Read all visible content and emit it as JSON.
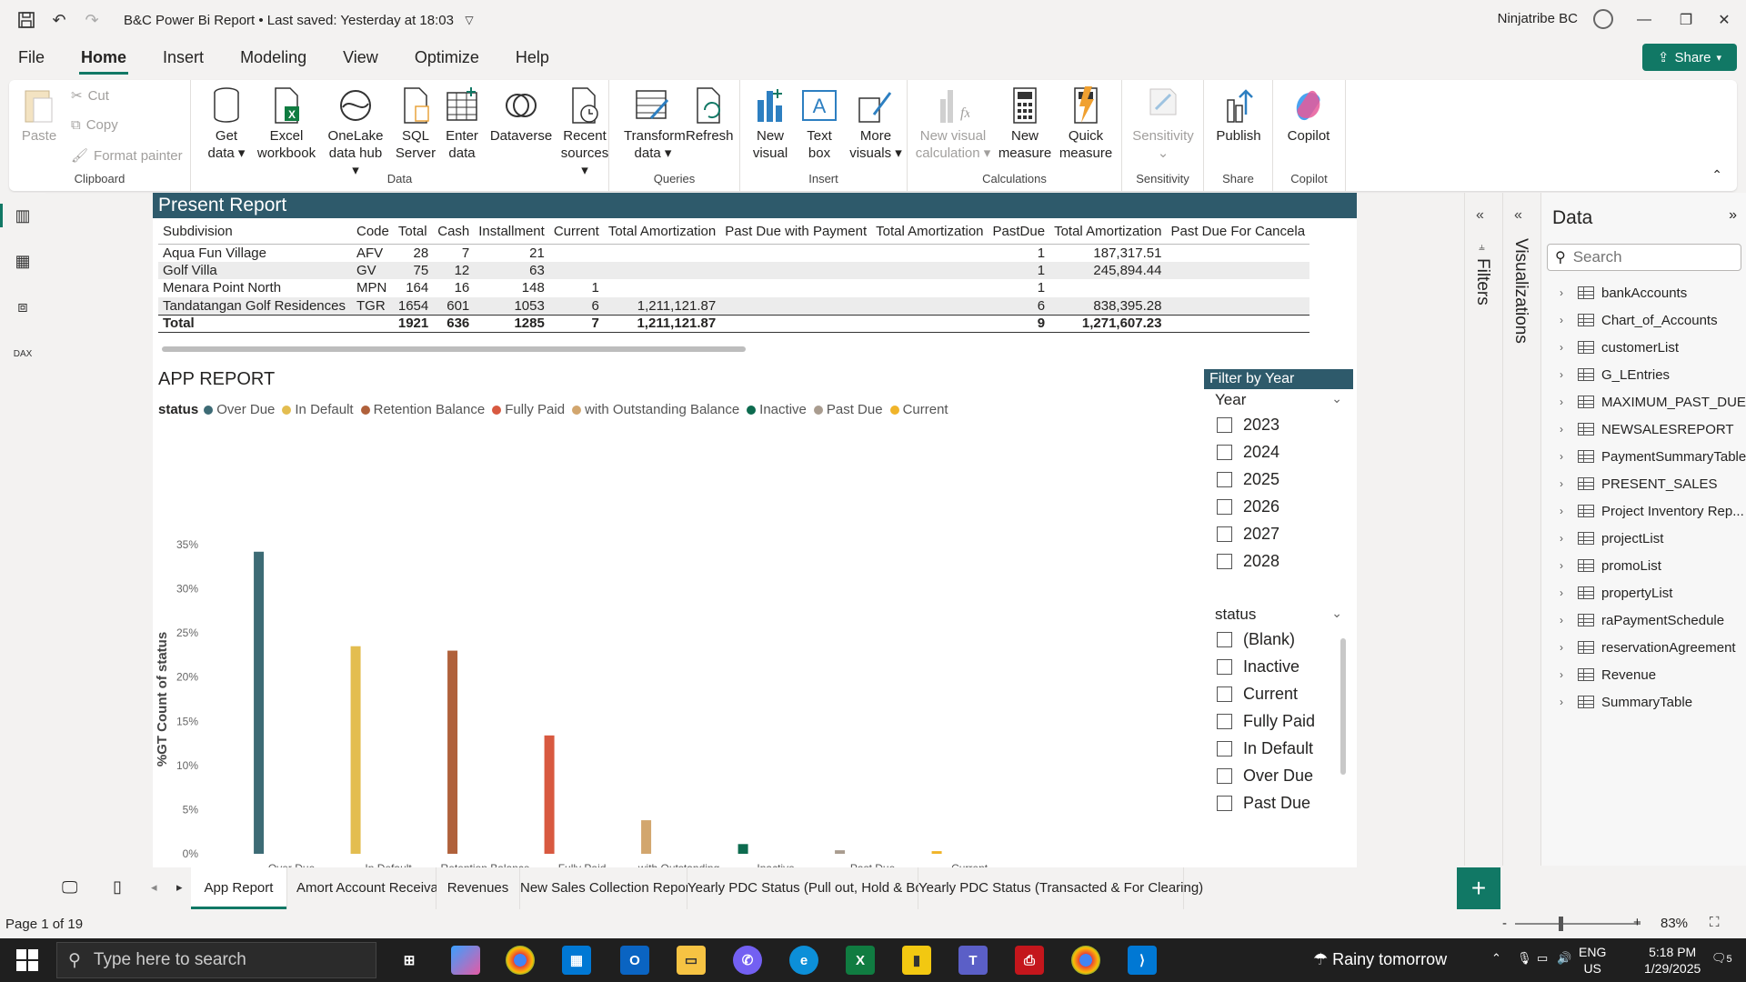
{
  "window": {
    "title": "B&C Power Bi Report • Last saved: Yesterday at 18:03",
    "user": "Ninjatribe BC"
  },
  "menu": {
    "tabs": [
      "File",
      "Home",
      "Insert",
      "Modeling",
      "View",
      "Optimize",
      "Help"
    ],
    "share_label": "Share"
  },
  "ribbon": {
    "clipboard": {
      "paste": "Paste",
      "cut": "Cut",
      "copy": "Copy",
      "format_painter": "Format painter",
      "label": "Clipboard"
    },
    "data": {
      "get_data": [
        "Get",
        "data"
      ],
      "excel": [
        "Excel",
        "workbook"
      ],
      "onelake": [
        "OneLake",
        "data hub"
      ],
      "sql": [
        "SQL",
        "Server"
      ],
      "enter": [
        "Enter",
        "data"
      ],
      "dataverse": [
        "Dataverse",
        ""
      ],
      "recent": [
        "Recent",
        "sources"
      ],
      "label": "Data"
    },
    "queries": {
      "transform": [
        "Transform",
        "data"
      ],
      "refresh": [
        "Refresh",
        ""
      ],
      "label": "Queries"
    },
    "insert": {
      "new_visual": [
        "New",
        "visual"
      ],
      "text_box": [
        "Text",
        "box"
      ],
      "more_visuals": [
        "More",
        "visuals"
      ],
      "label": "Insert"
    },
    "calculations": {
      "new_visual_calc": [
        "New visual",
        "calculation"
      ],
      "new_measure": [
        "New",
        "measure"
      ],
      "quick_measure": [
        "Quick",
        "measure"
      ],
      "label": "Calculations"
    },
    "sensitivity": {
      "btn": [
        "Sensitivity",
        ""
      ],
      "label": "Sensitivity"
    },
    "share": {
      "publish": [
        "Publish",
        ""
      ],
      "label": "Share"
    },
    "copilot": {
      "btn": [
        "Copilot",
        ""
      ],
      "label": "Copilot"
    }
  },
  "present_report": {
    "title": "Present Report",
    "columns": [
      "Subdivision",
      "Code",
      "Total",
      "Cash",
      "Installment",
      "Current",
      "Total Amortization",
      "Past Due with Payment",
      "Total Amortization",
      "PastDue",
      "Total Amortization",
      "Past Due For Cancela"
    ],
    "rows": [
      [
        "Aqua Fun Village",
        "AFV",
        "28",
        "7",
        "21",
        "",
        "",
        "",
        "",
        "1",
        "187,317.51",
        ""
      ],
      [
        "Golf Villa",
        "GV",
        "75",
        "12",
        "63",
        "",
        "",
        "",
        "",
        "1",
        "245,894.44",
        ""
      ],
      [
        "Menara Point North",
        "MPN",
        "164",
        "16",
        "148",
        "1",
        "",
        "",
        "",
        "1",
        "",
        ""
      ],
      [
        "Tandatangan Golf Residences",
        "TGR",
        "1654",
        "601",
        "1053",
        "6",
        "1,211,121.87",
        "",
        "",
        "6",
        "838,395.28",
        ""
      ]
    ],
    "total": [
      "Total",
      "",
      "1921",
      "636",
      "1285",
      "7",
      "1,211,121.87",
      "",
      "",
      "9",
      "1,271,607.23",
      ""
    ]
  },
  "app_report": {
    "title": "APP REPORT",
    "legend_title": "status"
  },
  "chart_data": {
    "type": "bar",
    "categories": [
      "Over Due",
      "In Default",
      "Retention Balance",
      "Fully Paid",
      "with Outstanding Balance",
      "Inactive",
      "Past Due",
      "Current"
    ],
    "values": [
      34.2,
      23.5,
      23.0,
      13.4,
      3.8,
      1.1,
      0.4,
      0.3
    ],
    "colors": [
      "#3d6b75",
      "#e3bd50",
      "#b0613b",
      "#d85940",
      "#d2a66e",
      "#0d6b4f",
      "#a99c8f",
      "#f0b429"
    ],
    "xlabel": "status",
    "ylabel": "%GT Count of status",
    "ylim": [
      0,
      35
    ],
    "yticks": [
      "0%",
      "5%",
      "10%",
      "15%",
      "20%",
      "25%",
      "30%",
      "35%"
    ],
    "grid": false
  },
  "slicers": {
    "year": {
      "header": "Filter by Year",
      "field": "Year",
      "options": [
        "2023",
        "2024",
        "2025",
        "2026",
        "2027",
        "2028"
      ]
    },
    "status": {
      "field": "status",
      "options": [
        "(Blank)",
        "Inactive",
        "Current",
        "Fully Paid",
        "In Default",
        "Over Due",
        "Past Due"
      ]
    }
  },
  "panes": {
    "filters": "Filters",
    "visualizations": "Visualizations",
    "data": {
      "title": "Data",
      "search_placeholder": "Search",
      "tables": [
        "bankAccounts",
        "Chart_of_Accounts",
        "customerList",
        "G_LEntries",
        "MAXIMUM_PAST_DUE...",
        "NEWSALESREPORT",
        "PaymentSummaryTable",
        "PRESENT_SALES",
        "Project Inventory Rep...",
        "projectList",
        "promoList",
        "propertyList",
        "raPaymentSchedule",
        "reservationAgreement",
        "Revenue",
        "SummaryTable"
      ]
    }
  },
  "page_tabs": [
    "App Report",
    "Amort Account Receivables",
    "Revenues",
    "New Sales Collection Report",
    "Yearly PDC Status (Pull out, Hold & Bounced)",
    "Yearly PDC Status (Transacted & For Clearing)"
  ],
  "status_bar": {
    "page": "Page 1 of 19",
    "zoom": "83%"
  },
  "taskbar": {
    "search_placeholder": "Type here to search",
    "weather": "Rainy tomorrow",
    "lang": [
      "ENG",
      "US"
    ],
    "time": "5:18 PM",
    "date": "1/29/2025",
    "notif": "5"
  }
}
